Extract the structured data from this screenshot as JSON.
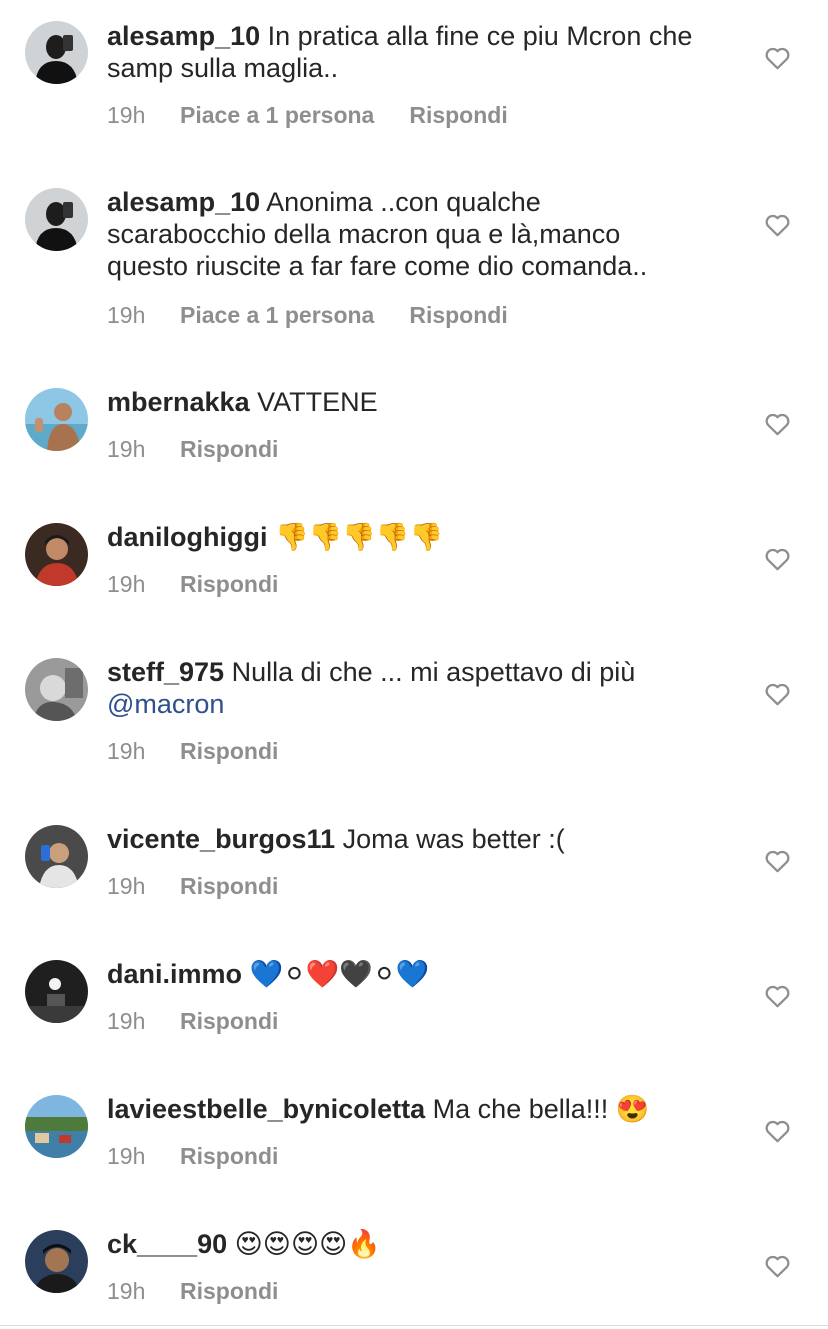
{
  "comments": [
    {
      "username": "alesamp_10",
      "text": "In pratica alla fine ce piu Mcron che samp sulla maglia..",
      "mention": "",
      "time": "19h",
      "likes": "Piace a 1 persona",
      "reply": "Rispondi"
    },
    {
      "username": "alesamp_10",
      "text": "Anonima ..con qualche scarabocchio della macron qua e là,manco questo riuscite a far fare come dio comanda..",
      "mention": "",
      "time": "19h",
      "likes": "Piace a 1 persona",
      "reply": "Rispondi"
    },
    {
      "username": "mbernakka",
      "text": "VATTENE",
      "mention": "",
      "time": "19h",
      "likes": "",
      "reply": "Rispondi"
    },
    {
      "username": "danilo­ghiggi",
      "text": "👎👎👎👎👎",
      "mention": "",
      "time": "19h",
      "likes": "",
      "reply": "Rispondi"
    },
    {
      "username": "steff_975",
      "text": "Nulla di che ... mi aspettavo di più",
      "mention": "@macron",
      "time": "19h",
      "likes": "",
      "reply": "Rispondi"
    },
    {
      "username": "vicente_burgos11",
      "text": "Joma was better :(",
      "mention": "",
      "time": "19h",
      "likes": "",
      "reply": "Rispondi"
    },
    {
      "username": "dani.immo",
      "text": "💙⚪❤️🖤⚪💙",
      "mention": "",
      "time": "19h",
      "likes": "",
      "reply": "Rispondi"
    },
    {
      "username": "lavieestbelle_bynicoletta",
      "text": "Ma che bella!!! 😍",
      "mention": "",
      "time": "19h",
      "likes": "",
      "reply": "Rispondi"
    },
    {
      "username": "ck____90",
      "text": "😍😍😍😍🔥",
      "mention": "",
      "time": "19h",
      "likes": "",
      "reply": "Rispondi"
    }
  ],
  "colors": {
    "text": "#262626",
    "meta": "#8e8e8e",
    "mention": "#2f4f8f",
    "heart_stroke": "#8e8e8e"
  },
  "icons": {
    "like": "heart-outline-icon"
  }
}
